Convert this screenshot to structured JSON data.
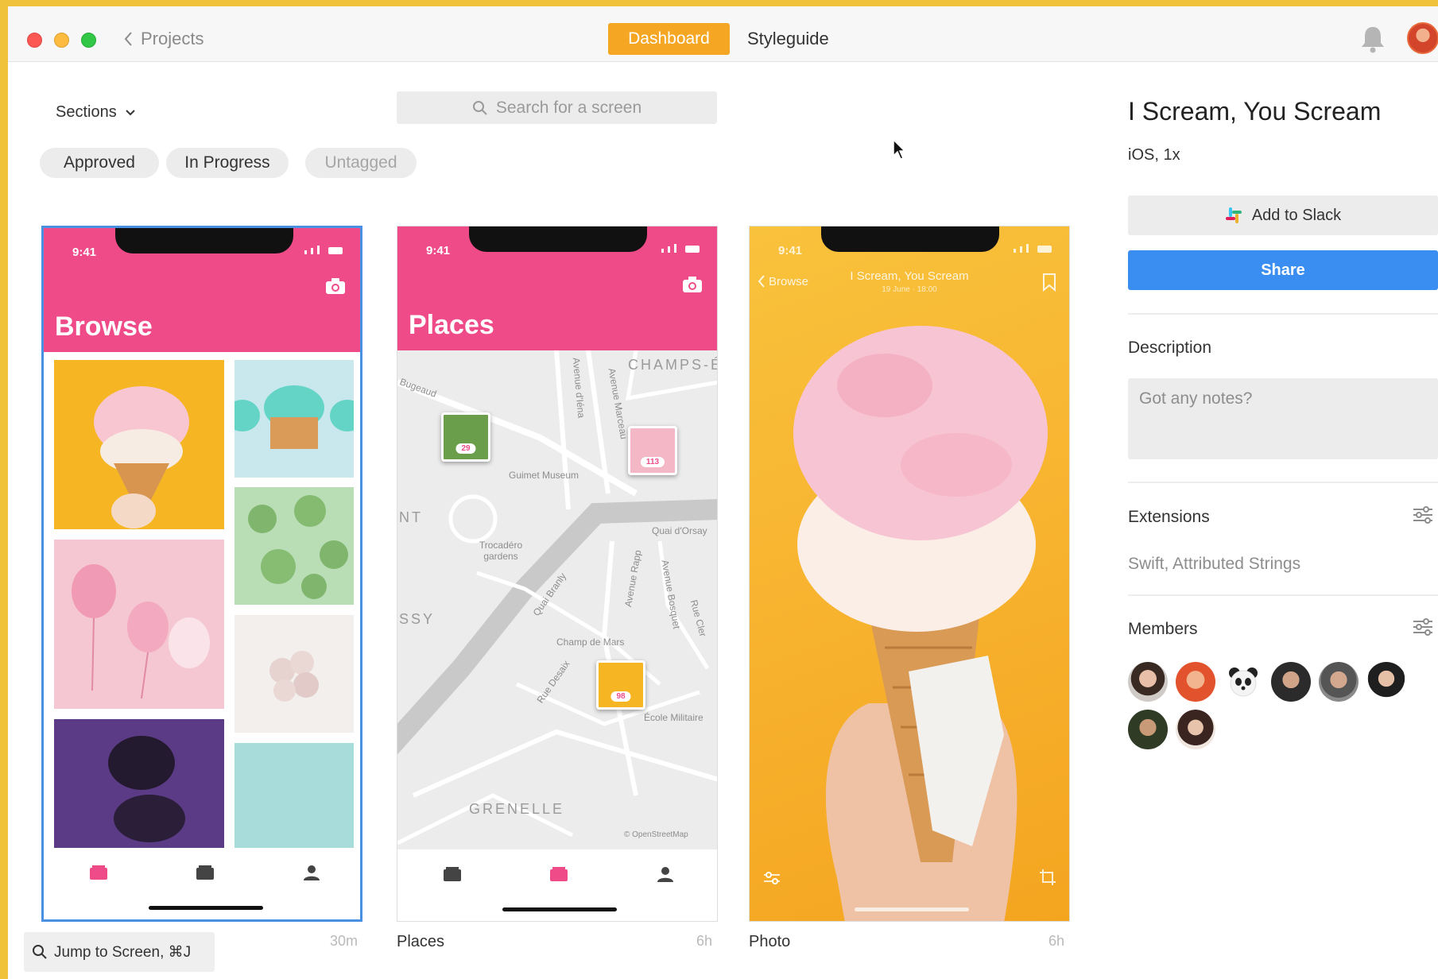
{
  "titlebar": {
    "back_label": "Projects",
    "tabs": [
      {
        "label": "Dashboard",
        "active": true
      },
      {
        "label": "Styleguide",
        "active": false
      }
    ]
  },
  "toolbar": {
    "sections_label": "Sections",
    "search_placeholder": "Search for a screen",
    "filters": [
      {
        "label": "Approved"
      },
      {
        "label": "In Progress"
      },
      {
        "label": "Untagged"
      }
    ]
  },
  "screens": [
    {
      "status_time": "9:41",
      "title": "Browse",
      "caption": "",
      "age": "30m"
    },
    {
      "status_time": "9:41",
      "title": "Places",
      "caption": "Places",
      "age": "6h"
    },
    {
      "status_time": "9:41",
      "title": "",
      "caption": "Photo",
      "age": "6h",
      "nav_back": "Browse",
      "nav_title": "I Scream, You Scream",
      "nav_subtitle": "19 June · 18:00"
    }
  ],
  "map": {
    "labels": [
      "CHAMPS-ÉLYSÉES",
      "Guimet Museum",
      "Trocadéro gardens",
      "Quai d'Orsay",
      "Champ de Mars",
      "École Militaire",
      "GRENELLE",
      "Avenue Marceau",
      "Avenue d'Iéna",
      "Quai Branly",
      "Avenue Rapp",
      "Avenue Bosquet",
      "Rue Cler",
      "Rue Desaix",
      "Bugeaud",
      "NT",
      "SSY",
      "© OpenStreetMap"
    ],
    "pins": [
      {
        "count": "29"
      },
      {
        "count": "113"
      },
      {
        "count": "98"
      }
    ]
  },
  "jump_to_screen": "Jump to Screen, ⌘J",
  "panel": {
    "title": "I Scream, You Scream",
    "platform": "iOS, 1x",
    "slack_label": "Add to Slack",
    "share_label": "Share",
    "description_heading": "Description",
    "notes_placeholder": "Got any notes?",
    "extensions_heading": "Extensions",
    "extensions_value": "Swift, Attributed Strings",
    "members_heading": "Members",
    "member_count": 8
  },
  "colors": {
    "accent_orange": "#f5a623",
    "share_blue": "#3a8ef2",
    "app_pink": "#ef4b89",
    "selection_blue": "#4a90e2"
  }
}
